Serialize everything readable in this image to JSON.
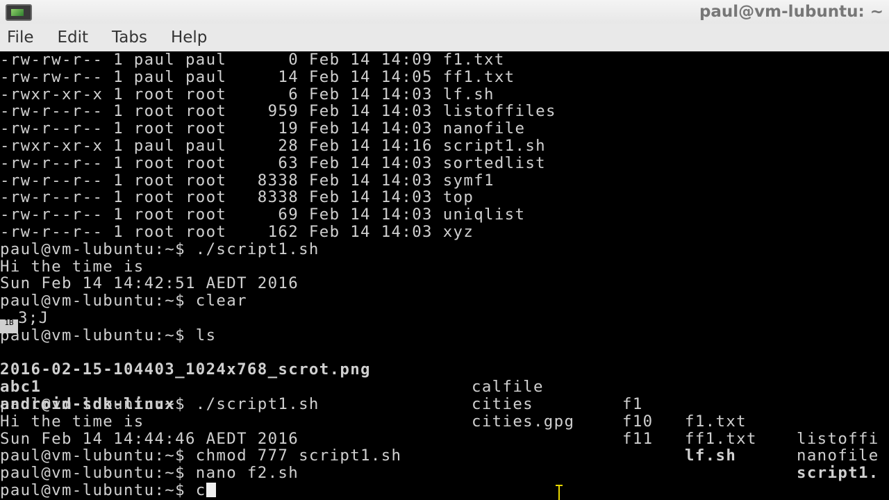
{
  "window": {
    "title": "paul@vm-lubuntu: ~"
  },
  "menu": [
    "File",
    "Edit",
    "Tabs",
    "Help"
  ],
  "terminal": {
    "lines_top": [
      "-rw-rw-r-- 1 paul paul      0 Feb 14 14:09 f1.txt",
      "-rw-rw-r-- 1 paul paul     14 Feb 14 14:05 ff1.txt",
      "-rwxr-xr-x 1 root root      6 Feb 14 14:03 lf.sh",
      "-rw-r--r-- 1 root root    959 Feb 14 14:03 listoffiles",
      "-rw-r--r-- 1 root root     19 Feb 14 14:03 nanofile",
      "-rwxr-xr-x 1 paul paul     28 Feb 14 14:16 script1.sh",
      "-rw-r--r-- 1 root root     63 Feb 14 14:03 sortedlist",
      "-rw-r--r-- 1 root root   8338 Feb 14 14:03 symf1",
      "-rw-r--r-- 1 root root   8338 Feb 14 14:03 top",
      "-rw-r--r-- 1 root root     69 Feb 14 14:03 uniqlist",
      "-rw-r--r-- 1 root root    162 Feb 14 14:03 xyz",
      "paul@vm-lubuntu:~$ ./script1.sh",
      "Hi the time is",
      "Sun Feb 14 14:42:51 AEDT 2016",
      "paul@vm-lubuntu:~$ clear"
    ],
    "ctrl_glyph": "1B",
    "ctrl_rest": "3;J",
    "ls_command": "paul@vm-lubuntu:~$ ls",
    "ls_items": {
      "col1": [
        {
          "text": "2016-02-15-104403_1024x768_scrot.png",
          "kind": "image"
        },
        {
          "text": "abc1",
          "kind": "exec"
        },
        {
          "text": "android-sdk-linux",
          "kind": "dir"
        }
      ],
      "col2": [
        "calfile",
        "cities",
        "cities.gpg"
      ],
      "col3": [
        "f1",
        "f10",
        "f11"
      ],
      "col4": [
        {
          "text": "f1.txt",
          "kind": "plain"
        },
        {
          "text": "ff1.txt",
          "kind": "plain"
        },
        {
          "text": "lf.sh",
          "kind": "exec"
        }
      ],
      "col5": [
        {
          "text": "listoffi",
          "kind": "plain"
        },
        {
          "text": "nanofile",
          "kind": "plain"
        },
        {
          "text": "script1.",
          "kind": "exec"
        }
      ]
    },
    "lines_bottom": [
      "paul@vm-lubuntu:~$ ./script1.sh",
      "Hi the time is",
      "Sun Feb 14 14:44:46 AEDT 2016",
      "paul@vm-lubuntu:~$ chmod 777 script1.sh",
      "paul@vm-lubuntu:~$ nano f2.sh"
    ],
    "current_prompt": "paul@vm-lubuntu:~$ c"
  },
  "colors": {
    "image": "#ff3fd2",
    "exec": "#39d93a",
    "dir": "#4a5cff",
    "text": "#d0d0d0",
    "background": "#000000"
  }
}
